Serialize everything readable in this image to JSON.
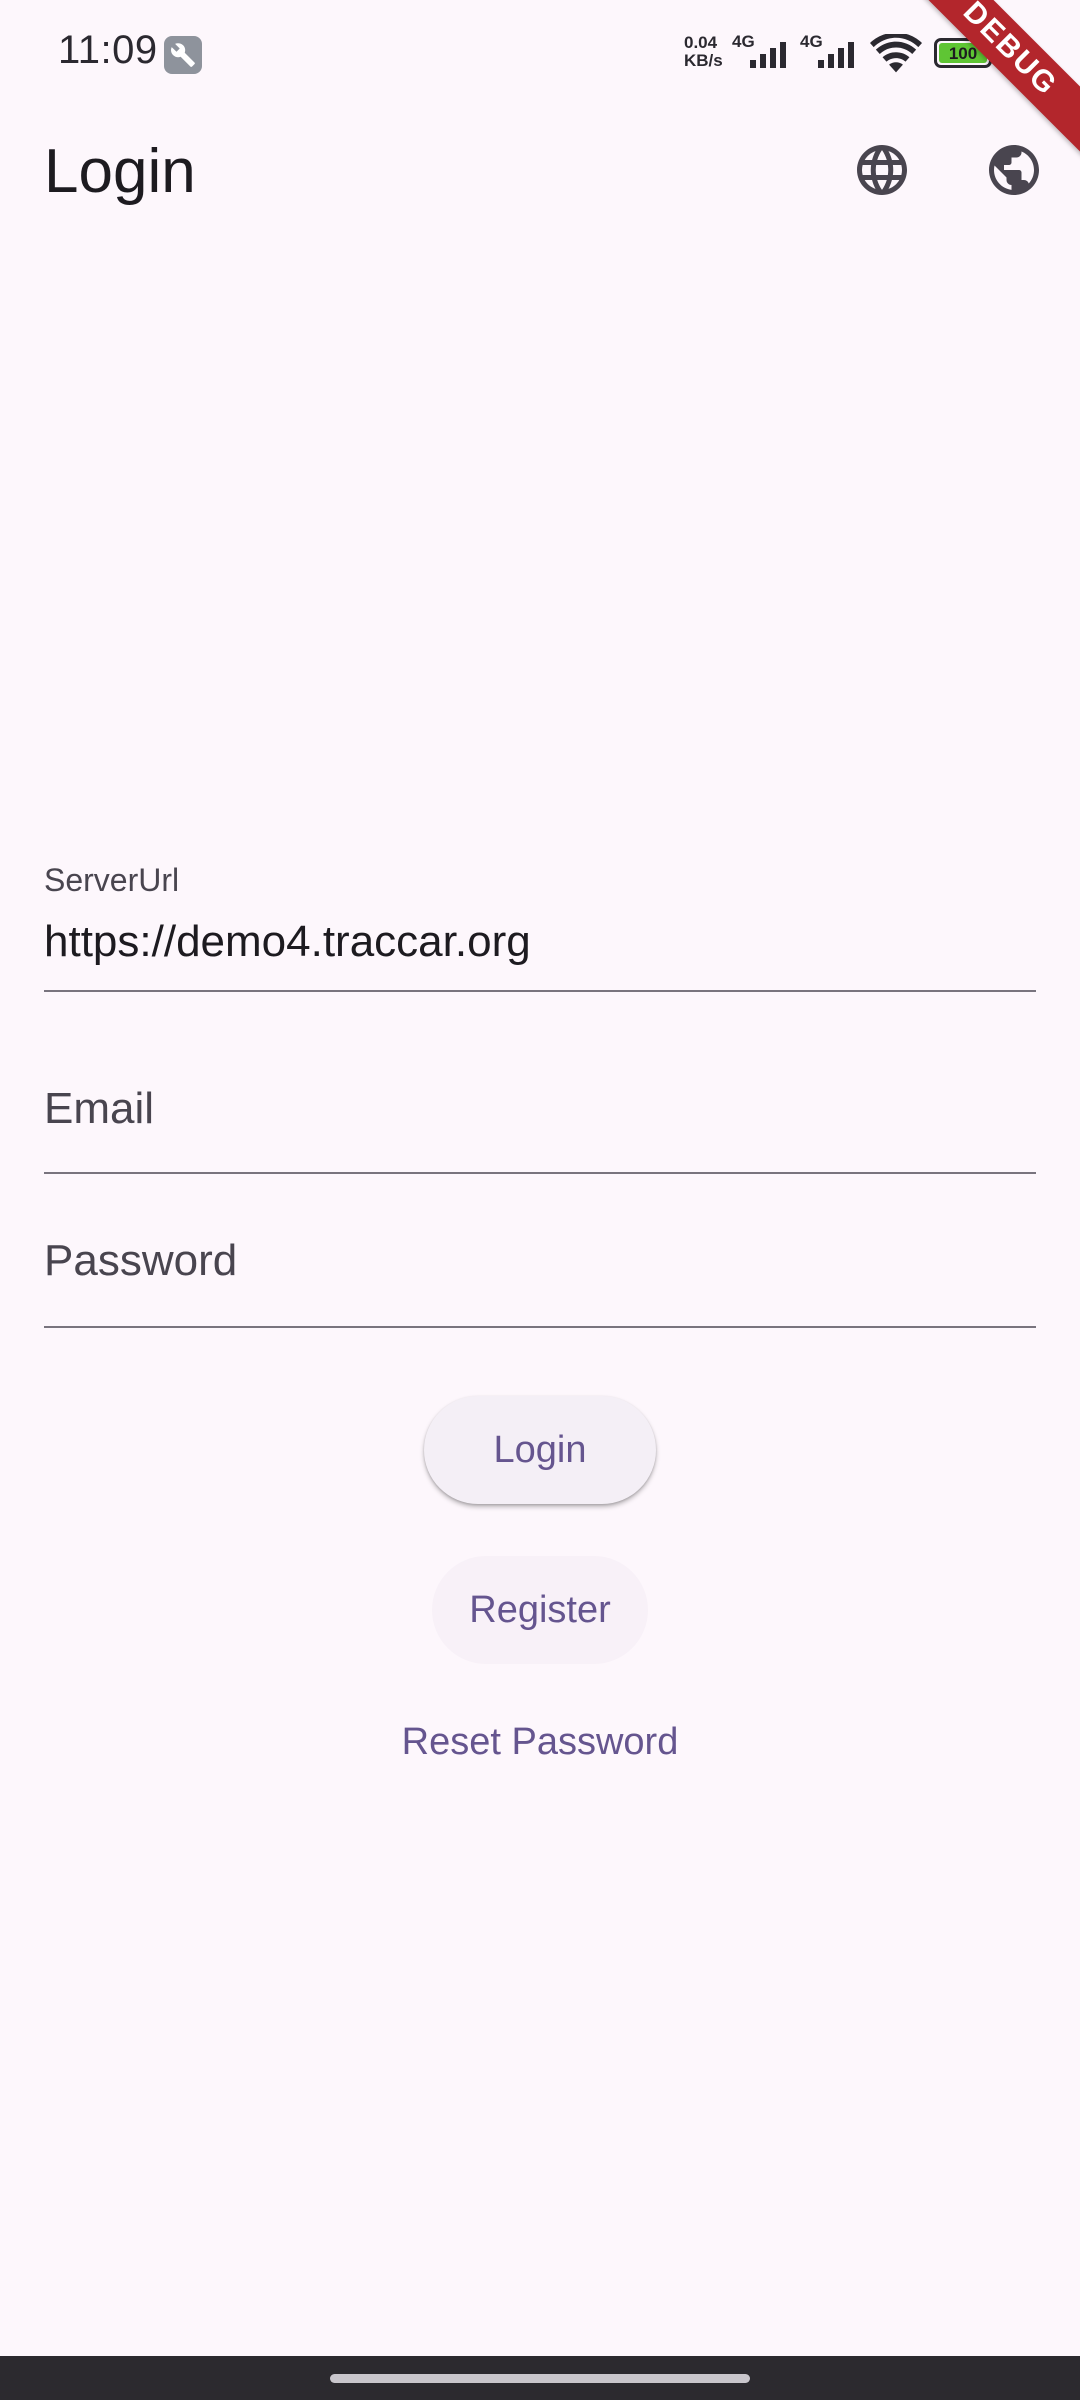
{
  "status_bar": {
    "time": "11:09",
    "net_speed_value": "0.04",
    "net_speed_unit": "KB/s",
    "network_1": "4G",
    "network_2": "4G",
    "battery": "100"
  },
  "debug_ribbon": "DEBUG",
  "app_bar": {
    "title": "Login",
    "icons": [
      "language-icon",
      "public-globe-icon"
    ]
  },
  "form": {
    "server_url_label": "ServerUrl",
    "server_url_value": "https://demo4.traccar.org",
    "email_placeholder": "Email",
    "password_placeholder": "Password"
  },
  "actions": {
    "login_label": "Login",
    "register_label": "Register",
    "reset_password_label": "Reset Password"
  },
  "colors": {
    "background": "#fdf7fc",
    "primary": "#65558f",
    "debug": "#b3262c"
  }
}
